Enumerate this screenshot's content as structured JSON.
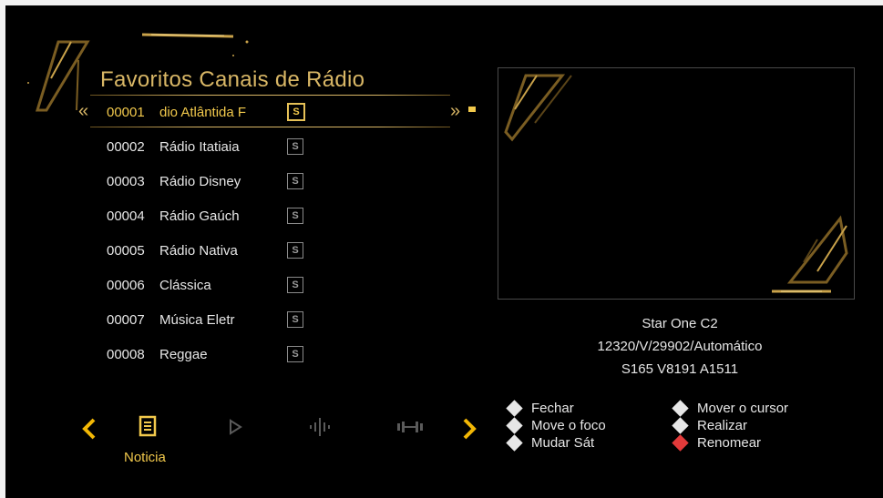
{
  "title": "Favoritos Canais de Rádio",
  "channels": [
    {
      "num": "00001",
      "name": "dio Atlântida F",
      "badge": "S",
      "selected": true
    },
    {
      "num": "00002",
      "name": "Rádio Itatiaia",
      "badge": "S"
    },
    {
      "num": "00003",
      "name": "Rádio Disney",
      "badge": "S"
    },
    {
      "num": "00004",
      "name": "Rádio Gaúch",
      "badge": "S"
    },
    {
      "num": "00005",
      "name": "Rádio Nativa",
      "badge": "S"
    },
    {
      "num": "00006",
      "name": "Clássica",
      "badge": "S"
    },
    {
      "num": "00007",
      "name": "Música Eletr",
      "badge": "S"
    },
    {
      "num": "00008",
      "name": "Reggae",
      "badge": "S"
    }
  ],
  "info": {
    "satellite": "Star One C2",
    "transponder": "12320/V/29902/Automático",
    "pids": "S165  V8191  A1511"
  },
  "bottom": {
    "active_label": "Noticia",
    "icons": [
      "news-icon",
      "play-icon",
      "audio-wave-icon",
      "dumbbell-icon"
    ]
  },
  "legend": {
    "fechar": "Fechar",
    "move_foco": "Move o foco",
    "mudar_sat": "Mudar Sát",
    "mover_cursor": "Mover o cursor",
    "realizar": "Realizar",
    "renomear": "Renomear"
  },
  "colors": {
    "accent_gold": "#d9b766",
    "highlight_yellow": "#f2c94c",
    "nav_arrow": "#f2b705",
    "red_key": "#e23a3a",
    "white_key": "#e6e6e6"
  }
}
